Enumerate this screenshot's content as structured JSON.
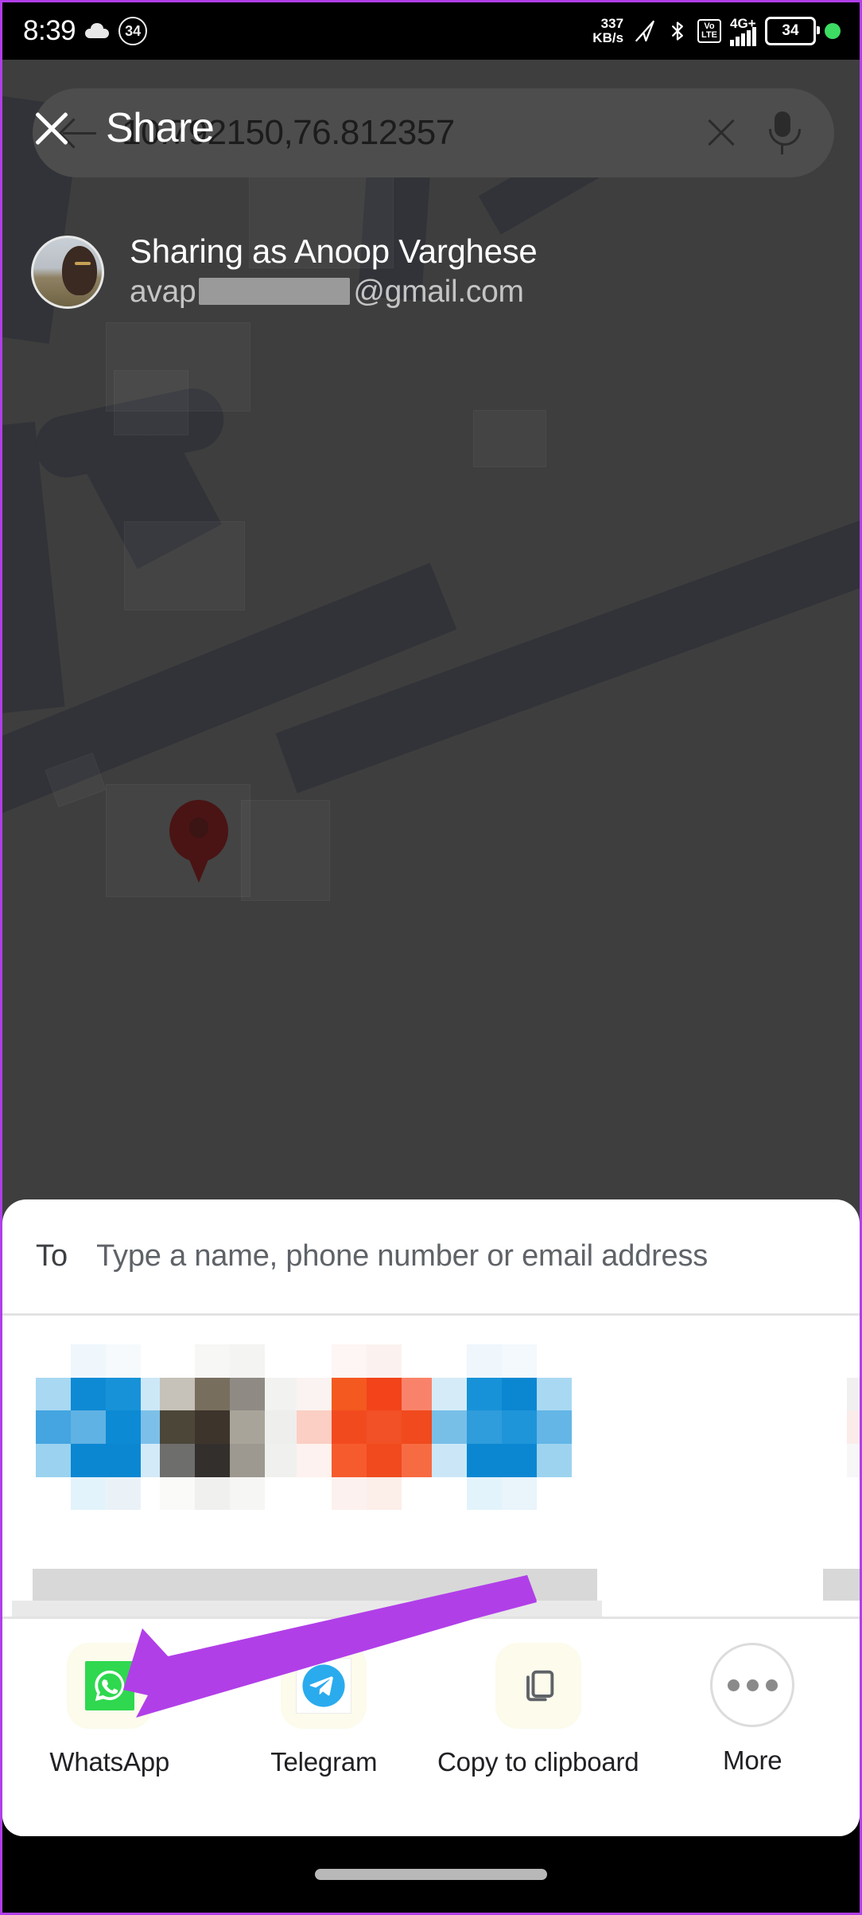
{
  "status_bar": {
    "time": "8:39",
    "weather_icon": "cloud-icon",
    "notification_count": "34",
    "network_speed_value": "337",
    "network_speed_unit": "KB/s",
    "location_icon": "location-arrow-icon",
    "bluetooth_icon": "bluetooth-icon",
    "volte_line1": "Vo",
    "volte_line2": "LTE",
    "network_type": "4G+",
    "signal_icon": "signal-bars-icon",
    "battery_level": "34",
    "recording_dot": "green-dot-icon"
  },
  "map": {
    "search": {
      "back_icon": "back-arrow-icon",
      "query": "10.792150,76.812357",
      "clear_icon": "clear-x-icon",
      "mic_icon": "microphone-icon"
    },
    "pin_icon": "map-pin-icon"
  },
  "share_overlay": {
    "close_icon": "close-x-icon",
    "title": "Share",
    "account": {
      "avatar": "user-avatar",
      "sharing_as": "Sharing as Anoop Varghese",
      "email_prefix": "avap",
      "email_suffix": "@gmail.com"
    }
  },
  "share_sheet": {
    "to_label": "To",
    "to_placeholder": "Type a name, phone number or email address",
    "contacts_blurred": [
      {
        "name": "contact-1",
        "color": "#1a8fd8"
      },
      {
        "name": "contact-2",
        "color": "#6d6358"
      },
      {
        "name": "contact-3",
        "color": "#f24e1e"
      },
      {
        "name": "contact-4",
        "color": "#1a8fd8"
      },
      {
        "name": "contact-5",
        "color": "#c8c8c8"
      }
    ],
    "apps": [
      {
        "label": "WhatsApp",
        "icon": "whatsapp-icon",
        "color": "#2fd84f"
      },
      {
        "label": "Telegram",
        "icon": "telegram-icon",
        "color": "#2aabee"
      },
      {
        "label": "Copy to clipboard",
        "icon": "copy-icon",
        "color": "#5f6368"
      },
      {
        "label": "More",
        "icon": "more-dots-icon",
        "color": "#8a8a8a"
      }
    ]
  },
  "navigation": {
    "home_indicator": "home-indicator"
  },
  "annotation": {
    "arrow_color": "#b13fe8",
    "points_to": "WhatsApp"
  }
}
